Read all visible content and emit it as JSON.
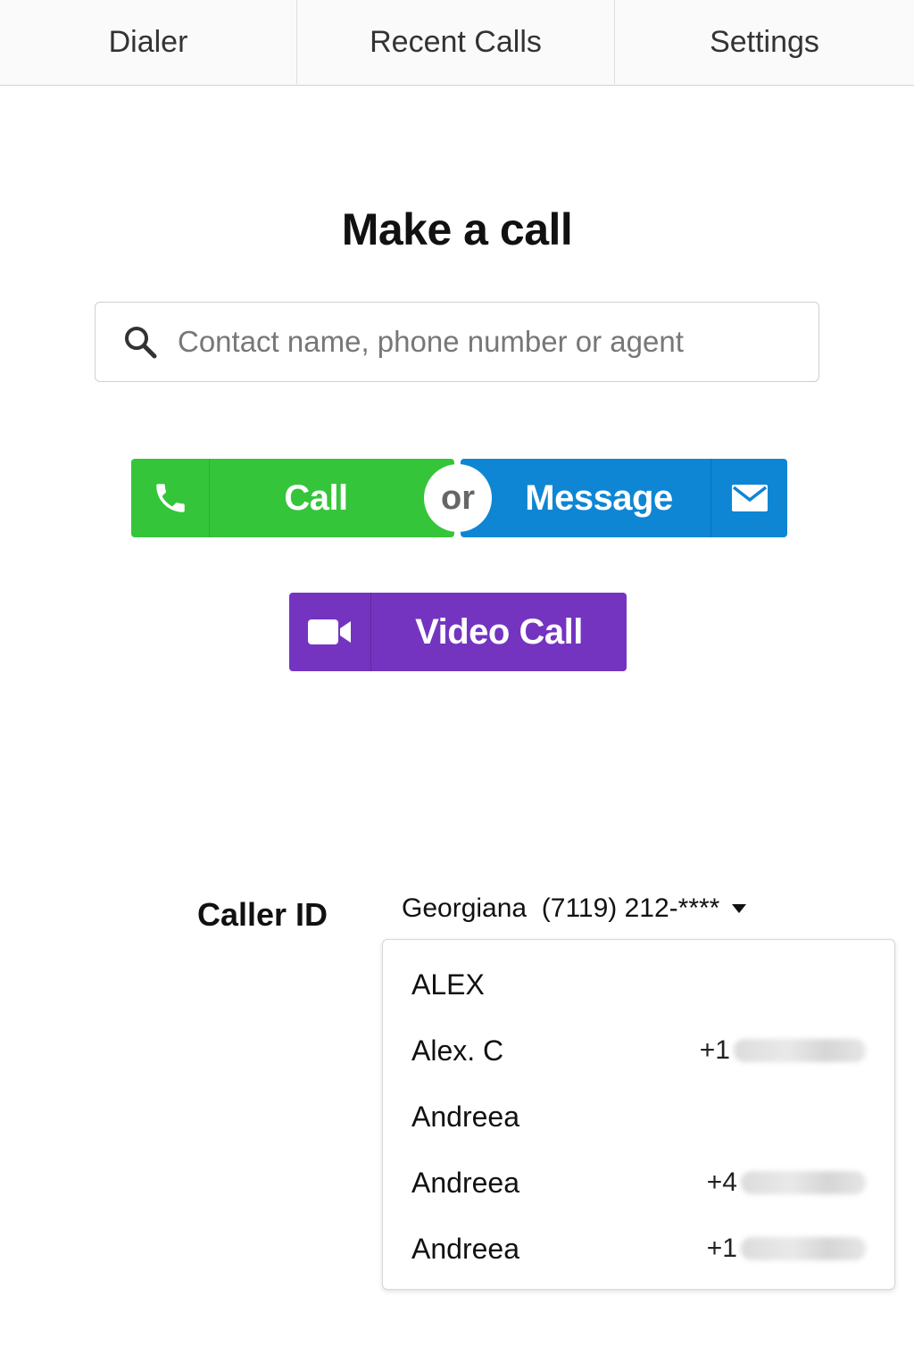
{
  "tabs": [
    {
      "label": "Dialer"
    },
    {
      "label": "Recent Calls"
    },
    {
      "label": "Settings"
    }
  ],
  "main": {
    "title": "Make a call",
    "search": {
      "placeholder": "Contact name, phone number or agent",
      "value": ""
    },
    "actions": {
      "call_label": "Call",
      "or_label": "or",
      "message_label": "Message",
      "video_label": "Video Call"
    },
    "caller_id": {
      "label": "Caller ID",
      "selected": "Georgiana  (7119) 212-****",
      "options": [
        {
          "name": "ALEX",
          "number_prefix": ""
        },
        {
          "name": "Alex. C",
          "number_prefix": "+1"
        },
        {
          "name": "Andreea",
          "number_prefix": ""
        },
        {
          "name": "Andreea",
          "number_prefix": "+4"
        },
        {
          "name": "Andreea",
          "number_prefix": "+1"
        }
      ]
    }
  },
  "colors": {
    "call_green": "#35c53a",
    "message_blue": "#0e86d4",
    "video_purple": "#7434c0"
  },
  "icons": {
    "search": "search-icon",
    "call": "phone-icon",
    "message": "envelope-icon",
    "video": "video-camera-icon",
    "dropdown": "caret-down-icon"
  }
}
